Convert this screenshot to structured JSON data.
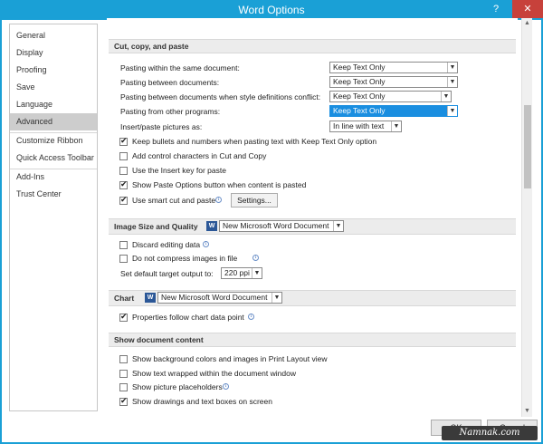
{
  "window": {
    "title": "Word Options",
    "help_label": "?",
    "close_label": "✕"
  },
  "nav": {
    "items": [
      "General",
      "Display",
      "Proofing",
      "Save",
      "Language",
      "Advanced",
      "Customize Ribbon",
      "Quick Access Toolbar",
      "Add-Ins",
      "Trust Center"
    ],
    "active": "Advanced"
  },
  "cut_copy_paste": {
    "header": "Cut, copy, and paste",
    "pasting_same_doc": {
      "label": "Pasting within the same document:",
      "value": "Keep Text Only"
    },
    "pasting_between_docs": {
      "label": "Pasting between documents:",
      "value": "Keep Text Only"
    },
    "pasting_conflict": {
      "label": "Pasting between documents when style definitions conflict:",
      "value": "Keep Text Only"
    },
    "pasting_other_programs": {
      "label": "Pasting from other programs:",
      "value": "Keep Text Only"
    },
    "insert_pictures": {
      "label": "Insert/paste pictures as:",
      "value": "In line with text"
    },
    "keep_bullets": {
      "label": "Keep bullets and numbers when pasting text with Keep Text Only option",
      "checked": true
    },
    "add_control_chars": {
      "label": "Add control characters in Cut and Copy",
      "checked": false
    },
    "use_insert_key": {
      "label": "Use the Insert key for paste",
      "checked": false
    },
    "show_paste_options": {
      "label": "Show Paste Options button when content is pasted",
      "checked": true
    },
    "smart_cut_paste": {
      "label": "Use smart cut and paste",
      "checked": true
    },
    "settings_button": "Settings..."
  },
  "image_size_quality": {
    "header": "Image Size and Quality",
    "document": "New Microsoft Word Document",
    "discard_editing": {
      "label": "Discard editing data",
      "checked": false
    },
    "no_compress": {
      "label": "Do not compress images in file",
      "checked": false
    },
    "target_output": {
      "label": "Set default target output to:",
      "value": "220 ppi"
    }
  },
  "chart": {
    "header": "Chart",
    "document": "New Microsoft Word Document",
    "properties_follow": {
      "label": "Properties follow chart data point",
      "checked": true
    }
  },
  "show_document_content": {
    "header": "Show document content",
    "items": [
      {
        "label": "Show background colors and images in Print Layout view",
        "checked": false
      },
      {
        "label": "Show text wrapped within the document window",
        "checked": false
      },
      {
        "label": "Show picture placeholders",
        "checked": false
      },
      {
        "label": "Show drawings and text boxes on screen",
        "checked": true
      }
    ]
  },
  "footer": {
    "ok_label": "OK",
    "cancel_label": "Cancel"
  },
  "watermark": "Namnak.com",
  "colors": {
    "accent": "#1aa0d6",
    "selection": "#1a8ee0",
    "close": "#c7413b"
  }
}
